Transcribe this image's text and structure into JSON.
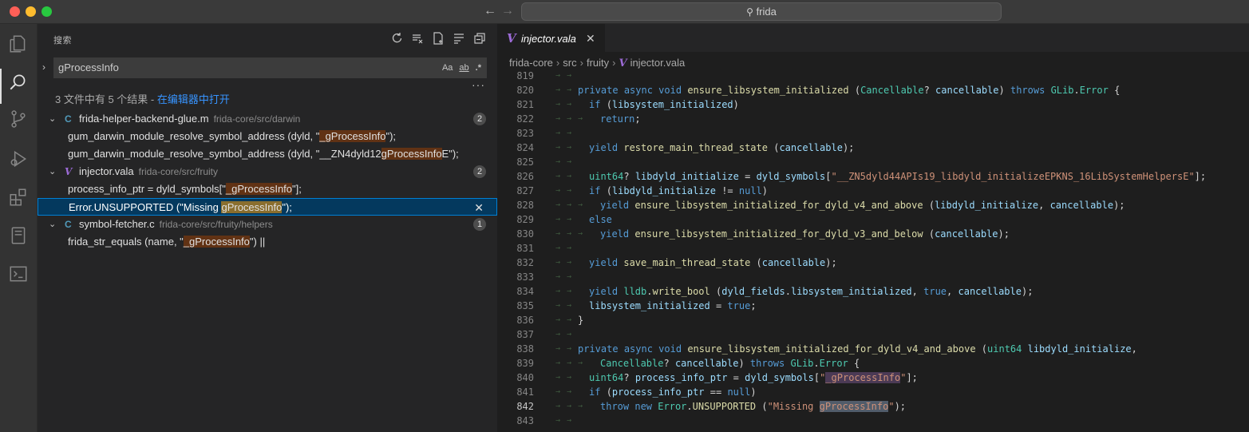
{
  "window": {
    "command_center_text": "frida"
  },
  "sidebar": {
    "title": "搜索",
    "search_value": "gProcessInfo",
    "options": [
      "Aa",
      "ab",
      ".*"
    ],
    "summary_prefix": "3 文件中有 5 个结果 - ",
    "summary_link": "在编辑器中打开",
    "results": [
      {
        "file": "frida-helper-backend-glue.m",
        "path": "frida-core/src/darwin",
        "icon": "C",
        "count": "2",
        "matches": [
          {
            "pre": "gum_darwin_module_resolve_symbol_address (dyld, \"",
            "hit": "_gProcessInfo",
            "post": "\");"
          },
          {
            "pre": "gum_darwin_module_resolve_symbol_address (dyld, \"__ZN4dyld12",
            "hit": "gProcessInfo",
            "post": "E\");"
          }
        ]
      },
      {
        "file": "injector.vala",
        "path": "frida-core/src/fruity",
        "icon": "V",
        "count": "2",
        "matches": [
          {
            "pre": "process_info_ptr = dyld_symbols[\"",
            "hit": "_gProcessInfo",
            "post": "\"];"
          },
          {
            "pre": "Error.UNSUPPORTED (\"Missing ",
            "hit": "gProcessInfo",
            "post": "\");"
          }
        ]
      },
      {
        "file": "symbol-fetcher.c",
        "path": "frida-core/src/fruity/helpers",
        "icon": "C",
        "count": "1",
        "matches": [
          {
            "pre": "frida_str_equals (name, \"",
            "hit": "_gProcessInfo",
            "post": "\") ||"
          }
        ]
      }
    ]
  },
  "editor": {
    "tab_label": "injector.vala",
    "breadcrumb": [
      "frida-core",
      "src",
      "fruity",
      "injector.vala"
    ],
    "lines": [
      {
        "n": "819",
        "t": ""
      },
      {
        "n": "820",
        "t": "private async void ensure_libsystem_initialized (Cancellable? cancellable) throws GLib.Error {"
      },
      {
        "n": "821",
        "t": "  if (libsystem_initialized)"
      },
      {
        "n": "822",
        "t": "    return;"
      },
      {
        "n": "823",
        "t": ""
      },
      {
        "n": "824",
        "t": "  yield restore_main_thread_state (cancellable);"
      },
      {
        "n": "825",
        "t": ""
      },
      {
        "n": "826",
        "t": "  uint64? libdyld_initialize = dyld_symbols[\"__ZN5dyld44APIs19_libdyld_initializeEPKNS_16LibSystemHelpersE\"];"
      },
      {
        "n": "827",
        "t": "  if (libdyld_initialize != null)"
      },
      {
        "n": "828",
        "t": "    yield ensure_libsystem_initialized_for_dyld_v4_and_above (libdyld_initialize, cancellable);"
      },
      {
        "n": "829",
        "t": "  else"
      },
      {
        "n": "830",
        "t": "    yield ensure_libsystem_initialized_for_dyld_v3_and_below (cancellable);"
      },
      {
        "n": "831",
        "t": ""
      },
      {
        "n": "832",
        "t": "  yield save_main_thread_state (cancellable);"
      },
      {
        "n": "833",
        "t": ""
      },
      {
        "n": "834",
        "t": "  yield lldb.write_bool (dyld_fields.libsystem_initialized, true, cancellable);"
      },
      {
        "n": "835",
        "t": "  libsystem_initialized = true;"
      },
      {
        "n": "836",
        "t": "}"
      },
      {
        "n": "837",
        "t": ""
      },
      {
        "n": "838",
        "t": "private async void ensure_libsystem_initialized_for_dyld_v4_and_above (uint64 libdyld_initialize,"
      },
      {
        "n": "839",
        "t": "    Cancellable? cancellable) throws GLib.Error {"
      },
      {
        "n": "840",
        "t": "  uint64? process_info_ptr = dyld_symbols[\"_gProcessInfo\"];"
      },
      {
        "n": "841",
        "t": "  if (process_info_ptr == null)"
      },
      {
        "n": "842",
        "t": "    throw new Error.UNSUPPORTED (\"Missing gProcessInfo\");"
      },
      {
        "n": "843",
        "t": ""
      }
    ]
  },
  "colors": {
    "accent": "#007fd4",
    "match_highlight": "#613214",
    "vala_icon": "#9c6bd6"
  }
}
